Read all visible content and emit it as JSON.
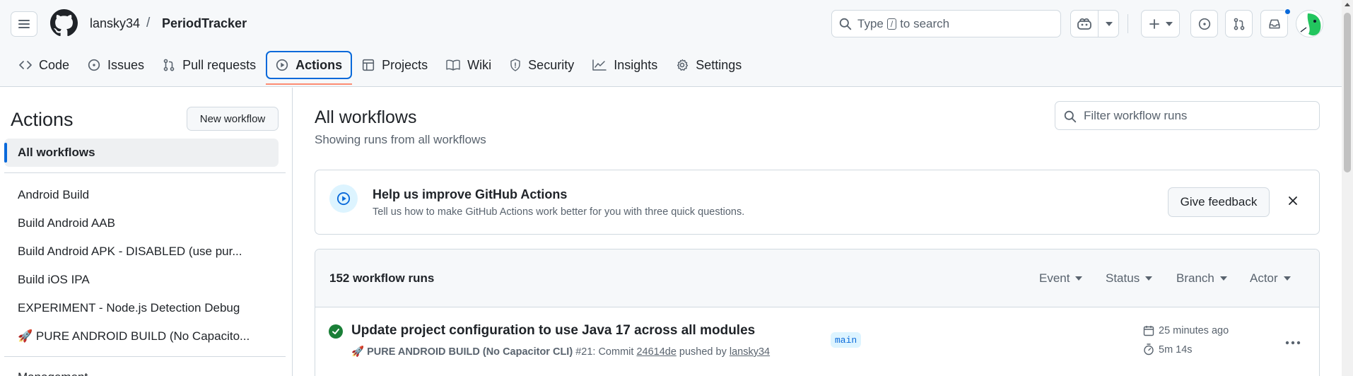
{
  "header": {
    "owner": "lansky34",
    "separator": "/",
    "repo": "PeriodTracker",
    "search_prefix": "Type",
    "search_key": "/",
    "search_suffix": "to search"
  },
  "tabs": [
    {
      "label": "Code",
      "icon": "code-icon"
    },
    {
      "label": "Issues",
      "icon": "issue-icon"
    },
    {
      "label": "Pull requests",
      "icon": "pull-request-icon"
    },
    {
      "label": "Actions",
      "icon": "play-icon",
      "active": true
    },
    {
      "label": "Projects",
      "icon": "table-icon"
    },
    {
      "label": "Wiki",
      "icon": "book-icon"
    },
    {
      "label": "Security",
      "icon": "shield-icon"
    },
    {
      "label": "Insights",
      "icon": "graph-icon"
    },
    {
      "label": "Settings",
      "icon": "gear-icon"
    }
  ],
  "sidebar": {
    "title": "Actions",
    "new_workflow": "New workflow",
    "all_workflows": "All workflows",
    "items": [
      {
        "label": "Android Build"
      },
      {
        "label": "Build Android AAB"
      },
      {
        "label": "Build Android APK - DISABLED (use pur..."
      },
      {
        "label": "Build iOS IPA"
      },
      {
        "label": "EXPERIMENT - Node.js Detection Debug"
      },
      {
        "label": "🚀 PURE ANDROID BUILD (No Capacito..."
      }
    ],
    "more": "Management"
  },
  "main": {
    "title": "All workflows",
    "subtitle": "Showing runs from all workflows",
    "filter_placeholder": "Filter workflow runs"
  },
  "banner": {
    "title": "Help us improve GitHub Actions",
    "text": "Tell us how to make GitHub Actions work better for you with three quick questions.",
    "button": "Give feedback"
  },
  "runs": {
    "count": "152 workflow runs",
    "filters": [
      "Event",
      "Status",
      "Branch",
      "Actor"
    ],
    "items": [
      {
        "title": "Update project configuration to use Java 17 across all modules",
        "workflow": "🚀 PURE ANDROID BUILD (No Capacitor CLI)",
        "run_number": "#21: Commit",
        "commit": "24614de",
        "pushed_by": "pushed by",
        "user": "lansky34",
        "branch": "main",
        "time_ago": "25 minutes ago",
        "duration": "5m 14s",
        "status": "success"
      }
    ]
  },
  "colors": {
    "accent": "#0969da",
    "success": "#1a7f37",
    "tab_underline": "#fd8c73",
    "border": "#d1d9e0"
  }
}
